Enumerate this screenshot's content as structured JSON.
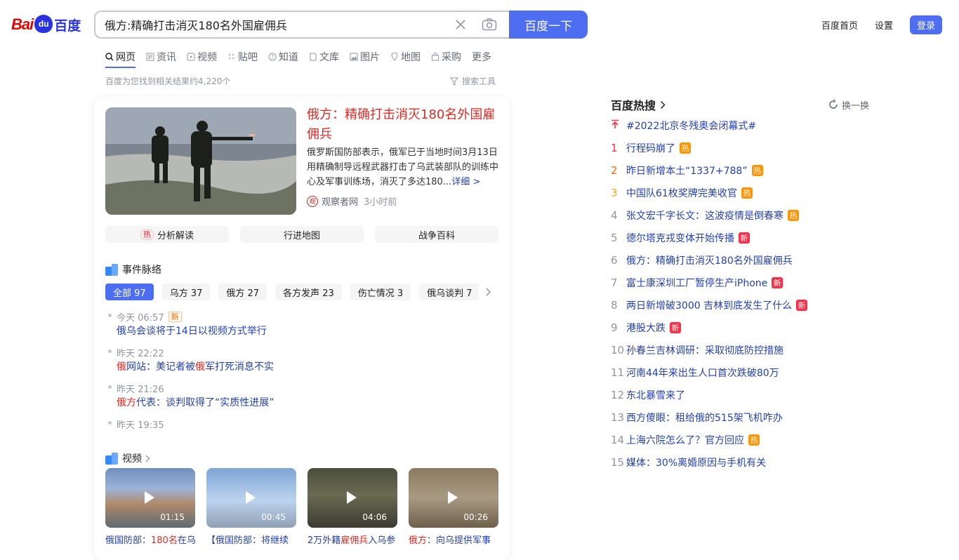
{
  "logo": {
    "bai": "Bai",
    "paw": "du",
    "cn": "百度"
  },
  "search": {
    "query": "俄方:精确打击消灭180名外国雇佣兵",
    "button": "百度一下"
  },
  "top_links": {
    "home": "百度首页",
    "settings": "设置",
    "login": "登录"
  },
  "tabs": [
    {
      "label": "网页",
      "icon": "search-icon",
      "active": true
    },
    {
      "label": "资讯",
      "icon": "news-icon"
    },
    {
      "label": "视频",
      "icon": "video-icon"
    },
    {
      "label": "贴吧",
      "icon": "tieba-icon"
    },
    {
      "label": "知道",
      "icon": "question-icon"
    },
    {
      "label": "文库",
      "icon": "doc-icon"
    },
    {
      "label": "图片",
      "icon": "image-icon"
    },
    {
      "label": "地图",
      "icon": "map-icon"
    },
    {
      "label": "采购",
      "icon": "shop-icon"
    },
    {
      "label": "更多"
    }
  ],
  "result_count": "百度为您找到相关结果约4,220个",
  "search_tools": "搜索工具",
  "news": {
    "title_a": "俄方",
    "title_sep": "：",
    "title_b": "精确打击消灭180名外国雇佣兵",
    "abstract": "俄罗斯国防部表示，俄军已于当地时间3月13日用精确制导远程武器打击了乌武装部队的训练中心及军事训练场，消灭了多达180...",
    "more": "详细 >",
    "source_icon": "观",
    "source": "观察者网",
    "time": "3小时前"
  },
  "quick_buttons": {
    "hot_tag": "热",
    "analysis": "分析解读",
    "map": "行进地图",
    "encyclopedia": "战争百科"
  },
  "events": {
    "title": "事件脉络",
    "chips": [
      "全部 97",
      "乌方 37",
      "俄方 27",
      "各方发声 23",
      "伤亡情况 3",
      "俄乌谈判 7"
    ],
    "items": [
      {
        "time": "今天 06:57",
        "tag": "新",
        "parts": [
          [
            "",
            "俄乌会谈将于14日以视频方式举行"
          ]
        ]
      },
      {
        "time": "昨天 22:22",
        "parts": [
          [
            "hl",
            "俄"
          ],
          [
            "",
            "网站：美记者被"
          ],
          [
            "hl",
            "俄"
          ],
          [
            "",
            "军打死消息不实"
          ]
        ]
      },
      {
        "time": "昨天 21:26",
        "parts": [
          [
            "hl",
            "俄方"
          ],
          [
            "",
            "代表：谈判取得了“实质性进展”"
          ]
        ]
      },
      {
        "time": "昨天 19:35",
        "parts": []
      }
    ]
  },
  "videos": {
    "title": "视频",
    "items": [
      {
        "duration": "01:15",
        "title_parts": [
          [
            "",
            "俄国防部："
          ],
          [
            "hl",
            "180名"
          ],
          [
            "",
            "在乌"
          ]
        ]
      },
      {
        "duration": "00:45",
        "title_parts": [
          [
            "",
            "【俄国防部：将继续"
          ]
        ]
      },
      {
        "duration": "04:06",
        "title_parts": [
          [
            "",
            "2万外籍"
          ],
          [
            "hl",
            "雇佣兵"
          ],
          [
            "",
            "入乌参"
          ]
        ]
      },
      {
        "duration": "00:26",
        "title_parts": [
          [
            "hl",
            "俄方"
          ],
          [
            "",
            "：向乌提供军事"
          ]
        ]
      }
    ]
  },
  "hot": {
    "title": "百度热搜",
    "refresh": "换一换",
    "items": [
      {
        "idx": "top",
        "text": "#2022北京冬残奥会闭幕式#"
      },
      {
        "idx": "1",
        "text": "行程码崩了",
        "badge": "热"
      },
      {
        "idx": "2",
        "text": "昨日新增本土“1337+788”",
        "badge": "热"
      },
      {
        "idx": "3",
        "text": "中国队61枚奖牌完美收官",
        "badge": "热"
      },
      {
        "idx": "4",
        "text": "张文宏千字长文：这波疫情是倒春寒",
        "badge": "热"
      },
      {
        "idx": "5",
        "text": "德尔塔克戎变体开始传播",
        "badge": "新"
      },
      {
        "idx": "6",
        "text": "俄方：精确打击消灭180名外国雇佣兵"
      },
      {
        "idx": "7",
        "text": "富士康深圳工厂暂停生产iPhone",
        "badge": "新"
      },
      {
        "idx": "8",
        "text": "两日新增破3000 吉林到底发生了什么",
        "badge": "新"
      },
      {
        "idx": "9",
        "text": "港股大跌",
        "badge": "新"
      },
      {
        "idx": "10",
        "text": "孙春兰吉林调研：采取彻底防控措施"
      },
      {
        "idx": "11",
        "text": "河南44年来出生人口首次跌破80万"
      },
      {
        "idx": "12",
        "text": "东北暴雪来了"
      },
      {
        "idx": "13",
        "text": "西方傻眼：租给俄的515架飞机咋办"
      },
      {
        "idx": "14",
        "text": "上海六院怎么了？官方回应",
        "badge": "热"
      },
      {
        "idx": "15",
        "text": "媒体：30%离婚原因与手机有关"
      }
    ]
  },
  "colors": {
    "accent": "#4e6ef2",
    "link": "#2440b3",
    "highlight": "#e02b25",
    "hot": "#ff9406",
    "new": "#fe2d46"
  }
}
